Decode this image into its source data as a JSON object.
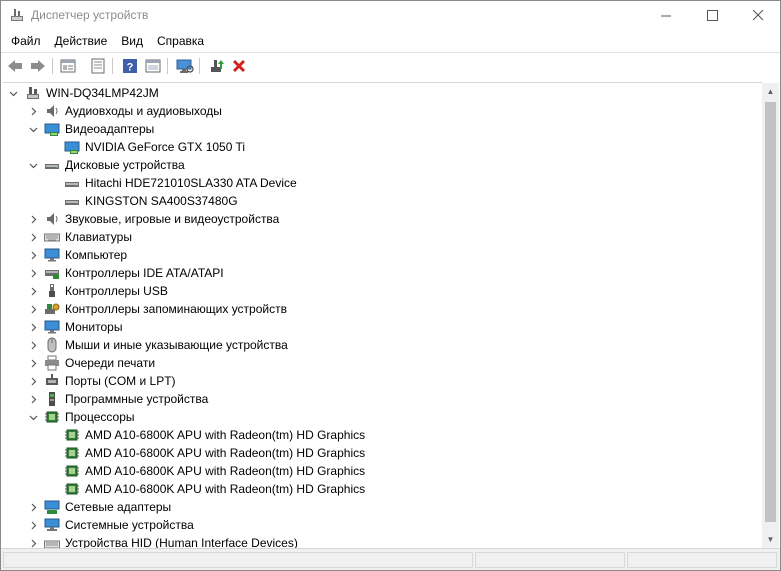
{
  "window": {
    "title": "Диспетчер устройств",
    "controls": {
      "minimize": "—",
      "maximize": "☐",
      "close": "✕"
    }
  },
  "menu": [
    "Файл",
    "Действие",
    "Вид",
    "Справка"
  ],
  "toolbar": [
    {
      "name": "back-icon"
    },
    {
      "name": "forward-icon"
    },
    {
      "name": "properties-icon"
    },
    {
      "name": "update-driver-icon"
    },
    {
      "name": "help-icon"
    },
    {
      "name": "show-hidden-icon"
    },
    {
      "name": "scan-hardware-icon"
    },
    {
      "name": "enable-device-icon"
    },
    {
      "name": "uninstall-device-icon"
    }
  ],
  "tree": {
    "root": "WIN-DQ34LMP42JM",
    "items": [
      {
        "label": "Аудиовходы и аудиовыходы",
        "icon": "speaker-icon",
        "expanded": false,
        "children": []
      },
      {
        "label": "Видеоадаптеры",
        "icon": "display-adapter-icon",
        "expanded": true,
        "children": [
          {
            "label": "NVIDIA GeForce GTX 1050 Ti",
            "icon": "display-adapter-icon"
          }
        ]
      },
      {
        "label": "Дисковые устройства",
        "icon": "disk-drive-icon",
        "expanded": true,
        "children": [
          {
            "label": "Hitachi HDE721010SLA330 ATA Device",
            "icon": "disk-drive-icon"
          },
          {
            "label": "KINGSTON SA400S37480G",
            "icon": "disk-drive-icon"
          }
        ]
      },
      {
        "label": "Звуковые, игровые и видеоустройства",
        "icon": "speaker-icon",
        "expanded": false,
        "children": []
      },
      {
        "label": "Клавиатуры",
        "icon": "keyboard-icon",
        "expanded": false,
        "children": []
      },
      {
        "label": "Компьютер",
        "icon": "computer-icon",
        "expanded": false,
        "children": []
      },
      {
        "label": "Контроллеры IDE ATA/ATAPI",
        "icon": "ide-controller-icon",
        "expanded": false,
        "children": []
      },
      {
        "label": "Контроллеры USB",
        "icon": "usb-icon",
        "expanded": false,
        "children": []
      },
      {
        "label": "Контроллеры запоминающих устройств",
        "icon": "storage-controller-icon",
        "expanded": false,
        "children": []
      },
      {
        "label": "Мониторы",
        "icon": "monitor-icon",
        "expanded": false,
        "children": []
      },
      {
        "label": "Мыши и иные указывающие устройства",
        "icon": "mouse-icon",
        "expanded": false,
        "children": []
      },
      {
        "label": "Очереди печати",
        "icon": "printer-icon",
        "expanded": false,
        "children": []
      },
      {
        "label": "Порты (COM и LPT)",
        "icon": "port-icon",
        "expanded": false,
        "children": []
      },
      {
        "label": "Программные устройства",
        "icon": "software-device-icon",
        "expanded": false,
        "children": []
      },
      {
        "label": "Процессоры",
        "icon": "processor-icon",
        "expanded": true,
        "children": [
          {
            "label": "AMD A10-6800K APU with Radeon(tm) HD Graphics",
            "icon": "processor-icon"
          },
          {
            "label": "AMD A10-6800K APU with Radeon(tm) HD Graphics",
            "icon": "processor-icon"
          },
          {
            "label": "AMD A10-6800K APU with Radeon(tm) HD Graphics",
            "icon": "processor-icon"
          },
          {
            "label": "AMD A10-6800K APU with Radeon(tm) HD Graphics",
            "icon": "processor-icon"
          }
        ]
      },
      {
        "label": "Сетевые адаптеры",
        "icon": "network-adapter-icon",
        "expanded": false,
        "children": []
      },
      {
        "label": "Системные устройства",
        "icon": "system-device-icon",
        "expanded": false,
        "children": []
      },
      {
        "label": "Устройства HID (Human Interface Devices)",
        "icon": "hid-icon",
        "expanded": false,
        "children": []
      }
    ]
  }
}
